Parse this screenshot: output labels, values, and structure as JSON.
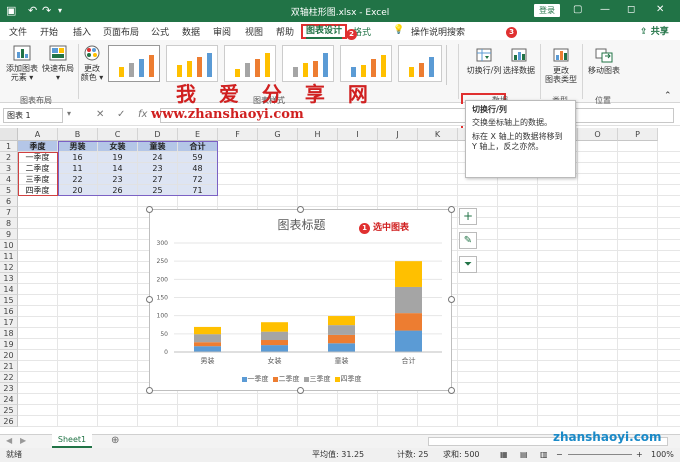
{
  "window": {
    "title": "双轴柱形图.xlsx - Excel",
    "login_label": "登录",
    "quick_access": [
      "↶",
      "↷",
      "▾"
    ],
    "controls": [
      "▢",
      "—",
      "◻",
      "✕"
    ]
  },
  "ribbon_tabs": [
    "文件",
    "开始",
    "插入",
    "页面布局",
    "公式",
    "数据",
    "审阅",
    "视图",
    "帮助",
    "图表设计",
    "格式"
  ],
  "active_tab": "图表设计",
  "tell_me": "操作说明搜索",
  "share_label": "共享",
  "badges": {
    "tab": "2",
    "button": "3",
    "chart": "1"
  },
  "ribbon": {
    "add_element": "添加图表\n元素 ▾",
    "quick_layout": "快速布局\n▾",
    "group_layout": "图表布局",
    "change_colors": "更改\n颜色 ▾",
    "group_styles": "图表样式",
    "switch_row_col": "切换行/列",
    "select_data": "选择数据",
    "group_data": "数据",
    "change_type": "更改\n图表类型",
    "group_type": "类型",
    "move_chart": "移动图表",
    "group_location": "位置"
  },
  "watermark": "我 爱 分 享 网",
  "site_url": "www.zhanshaoyi.com",
  "site_url_bottom": "zhanshaoyi.com",
  "tooltip": {
    "title": "切换行/列",
    "line1": "交换坐标轴上的数据。",
    "line2": "标在 X 轴上的数据将移到 Y 轴上，反之亦然。"
  },
  "formula_bar": {
    "name_box": "图表 1",
    "cancel": "✕",
    "enter": "✓",
    "fx": "fx"
  },
  "columns": [
    "A",
    "B",
    "C",
    "D",
    "E",
    "F",
    "G",
    "H",
    "I",
    "J",
    "K",
    "L",
    "M",
    "N",
    "O",
    "P"
  ],
  "rows": [
    "1",
    "2",
    "3",
    "4",
    "5",
    "6",
    "7",
    "8",
    "9",
    "10",
    "11",
    "12",
    "13",
    "14",
    "15",
    "16",
    "17",
    "18",
    "19",
    "20",
    "21",
    "22",
    "23",
    "24",
    "25",
    "26"
  ],
  "table": {
    "headers": [
      "季度",
      "男装",
      "女装",
      "童装",
      "合计"
    ],
    "rows": [
      [
        "一季度",
        "16",
        "19",
        "24",
        "59"
      ],
      [
        "二季度",
        "11",
        "14",
        "23",
        "48"
      ],
      [
        "三季度",
        "22",
        "23",
        "27",
        "72"
      ],
      [
        "四季度",
        "20",
        "26",
        "25",
        "71"
      ]
    ]
  },
  "chart_annotation": "选中图表",
  "colors": {
    "accent": "#217346",
    "red": "#e03030",
    "q1": "#5b9bd5",
    "q2": "#ed7d31",
    "q3": "#a5a5a5",
    "q4": "#ffc000"
  },
  "chart_data": {
    "type": "bar",
    "stacked": true,
    "title": "图表标题",
    "categories": [
      "男装",
      "女装",
      "童装",
      "合计"
    ],
    "series": [
      {
        "name": "一季度",
        "values": [
          16,
          19,
          24,
          59
        ]
      },
      {
        "name": "二季度",
        "values": [
          11,
          14,
          23,
          48
        ]
      },
      {
        "name": "三季度",
        "values": [
          22,
          23,
          27,
          72
        ]
      },
      {
        "name": "四季度",
        "values": [
          20,
          26,
          25,
          71
        ]
      }
    ],
    "yticks": [
      0,
      50,
      100,
      150,
      200,
      250,
      300
    ],
    "ylim": [
      0,
      300
    ],
    "legend": "bottom",
    "grid": true
  },
  "sheet": {
    "name": "Sheet1",
    "add": "⊕"
  },
  "status": {
    "mode": "就绪",
    "average": "平均值: 31.25",
    "count": "计数: 25",
    "sum": "求和: 500",
    "zoom": "100%"
  }
}
